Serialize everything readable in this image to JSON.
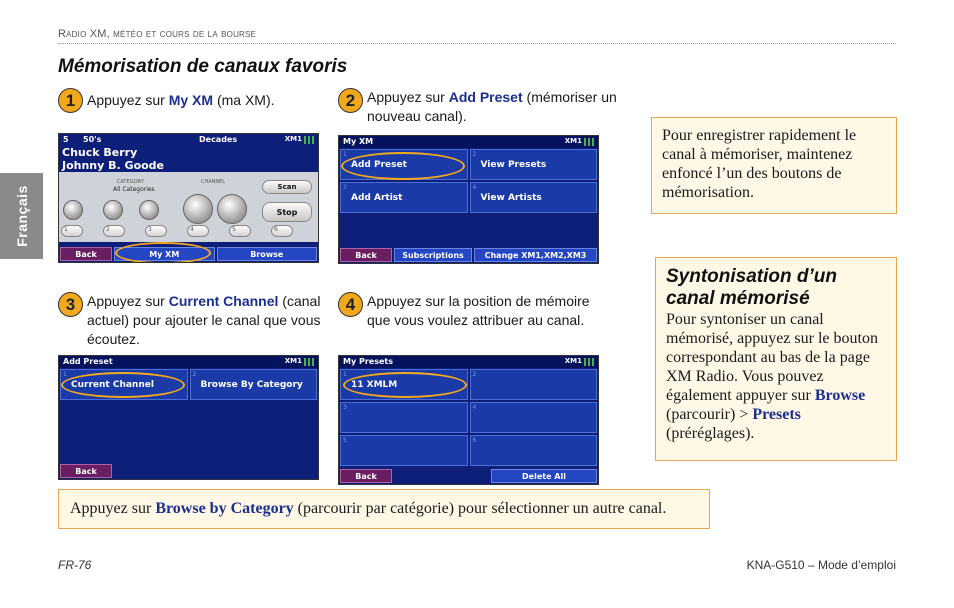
{
  "header": {
    "running_title": "Radio XM, météo et cours de la bourse"
  },
  "side_tab": {
    "label": "Français"
  },
  "section": {
    "title": "Mémorisation de canaux favoris"
  },
  "steps": [
    {
      "num": "1",
      "before": "Appuyez sur ",
      "keyword": "My XM",
      "after": " (ma XM)."
    },
    {
      "num": "2",
      "before": "Appuyez sur ",
      "keyword": "Add Preset",
      "after": " (mémoriser un nouveau canal)."
    },
    {
      "num": "3",
      "before": "Appuyez sur ",
      "keyword": "Current Channel",
      "after": " (canal actuel) pour ajouter le canal que vous écoutez."
    },
    {
      "num": "4",
      "before": "Appuyez sur la position de mémoire que vous voulez attribuer au canal.",
      "keyword": "",
      "after": ""
    }
  ],
  "screen1": {
    "channel": "5",
    "channel_name": "50's",
    "category": "Decades",
    "xm": "XM1",
    "artist": "Chuck Berry",
    "song": "Johnny B. Goode",
    "category_label": "CATEGORY",
    "category_value": "All Categories",
    "channel_label": "CHANNEL",
    "scan": "Scan",
    "stop": "Stop",
    "presets": [
      "1",
      "2",
      "3",
      "4",
      "5",
      "6"
    ],
    "bottom": [
      "Back",
      "My XM",
      "Browse"
    ]
  },
  "screen2": {
    "title": "My XM",
    "xm": "XM1",
    "cells": [
      "Add Preset",
      "View Presets",
      "Add Artist",
      "View Artists"
    ],
    "bottom": [
      "Back",
      "Subscriptions",
      "Change XM1,XM2,XM3"
    ]
  },
  "screen3": {
    "title": "Add Preset",
    "xm": "XM1",
    "cells": [
      "Current Channel",
      "Browse By Category"
    ],
    "bottom": [
      "Back"
    ]
  },
  "screen4": {
    "title": "My Presets",
    "xm": "XM1",
    "cells": [
      {
        "idx": "1",
        "label": "11   XMLM"
      },
      {
        "idx": "2",
        "label": ""
      },
      {
        "idx": "3",
        "label": ""
      },
      {
        "idx": "4",
        "label": ""
      },
      {
        "idx": "5",
        "label": ""
      },
      {
        "idx": "6",
        "label": ""
      }
    ],
    "bottom": [
      "Back",
      "Delete All"
    ]
  },
  "note_quick": {
    "text": "Pour enregistrer rapidement le canal à mémoriser, maintenez enfoncé l’un des boutons de mémorisation."
  },
  "note_tune": {
    "title": "Syntonisation d’un canal mémorisé",
    "before": "Pour syntoniser un canal mémorisé, appuyez sur le bouton correspondant au bas de la page XM Radio. Vous pouvez également appuyer sur ",
    "kw1": "Browse",
    "mid": " (parcourir) > ",
    "kw2": "Presets",
    "after": " (préréglages)."
  },
  "note_browse": {
    "before": "Appuyez sur ",
    "keyword": "Browse by Category",
    "after": " (parcourir par catégorie) pour sélectionner un autre canal."
  },
  "footer": {
    "page": "FR-76",
    "doc": "KNA-G510 – Mode d’emploi"
  },
  "colors": {
    "accent": "#f2a81d",
    "keyword": "#1b2f8e",
    "screen_blue": "#1a3aa8",
    "note_border": "#e6a64a"
  }
}
